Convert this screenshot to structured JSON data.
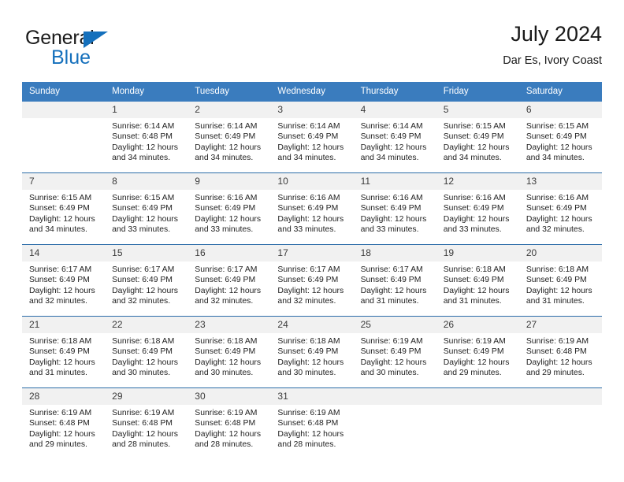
{
  "brand": {
    "name_top": "General",
    "name_bottom": "Blue",
    "accent_color": "#1570bc"
  },
  "header": {
    "title": "July 2024",
    "subtitle": "Dar Es, Ivory Coast",
    "header_bg_color": "#3a7cbe",
    "week_divider_color": "#2b6ca8",
    "daynum_bg_color": "#f1f1f1"
  },
  "weekday_headers": [
    "Sunday",
    "Monday",
    "Tuesday",
    "Wednesday",
    "Thursday",
    "Friday",
    "Saturday"
  ],
  "weeks": [
    [
      {
        "day": "",
        "sunrise": "",
        "sunset": "",
        "daylight": "",
        "daylight2": "",
        "empty": true
      },
      {
        "day": "1",
        "sunrise": "Sunrise: 6:14 AM",
        "sunset": "Sunset: 6:48 PM",
        "daylight": "Daylight: 12 hours",
        "daylight2": "and 34 minutes."
      },
      {
        "day": "2",
        "sunrise": "Sunrise: 6:14 AM",
        "sunset": "Sunset: 6:49 PM",
        "daylight": "Daylight: 12 hours",
        "daylight2": "and 34 minutes."
      },
      {
        "day": "3",
        "sunrise": "Sunrise: 6:14 AM",
        "sunset": "Sunset: 6:49 PM",
        "daylight": "Daylight: 12 hours",
        "daylight2": "and 34 minutes."
      },
      {
        "day": "4",
        "sunrise": "Sunrise: 6:14 AM",
        "sunset": "Sunset: 6:49 PM",
        "daylight": "Daylight: 12 hours",
        "daylight2": "and 34 minutes."
      },
      {
        "day": "5",
        "sunrise": "Sunrise: 6:15 AM",
        "sunset": "Sunset: 6:49 PM",
        "daylight": "Daylight: 12 hours",
        "daylight2": "and 34 minutes."
      },
      {
        "day": "6",
        "sunrise": "Sunrise: 6:15 AM",
        "sunset": "Sunset: 6:49 PM",
        "daylight": "Daylight: 12 hours",
        "daylight2": "and 34 minutes."
      }
    ],
    [
      {
        "day": "7",
        "sunrise": "Sunrise: 6:15 AM",
        "sunset": "Sunset: 6:49 PM",
        "daylight": "Daylight: 12 hours",
        "daylight2": "and 34 minutes."
      },
      {
        "day": "8",
        "sunrise": "Sunrise: 6:15 AM",
        "sunset": "Sunset: 6:49 PM",
        "daylight": "Daylight: 12 hours",
        "daylight2": "and 33 minutes."
      },
      {
        "day": "9",
        "sunrise": "Sunrise: 6:16 AM",
        "sunset": "Sunset: 6:49 PM",
        "daylight": "Daylight: 12 hours",
        "daylight2": "and 33 minutes."
      },
      {
        "day": "10",
        "sunrise": "Sunrise: 6:16 AM",
        "sunset": "Sunset: 6:49 PM",
        "daylight": "Daylight: 12 hours",
        "daylight2": "and 33 minutes."
      },
      {
        "day": "11",
        "sunrise": "Sunrise: 6:16 AM",
        "sunset": "Sunset: 6:49 PM",
        "daylight": "Daylight: 12 hours",
        "daylight2": "and 33 minutes."
      },
      {
        "day": "12",
        "sunrise": "Sunrise: 6:16 AM",
        "sunset": "Sunset: 6:49 PM",
        "daylight": "Daylight: 12 hours",
        "daylight2": "and 33 minutes."
      },
      {
        "day": "13",
        "sunrise": "Sunrise: 6:16 AM",
        "sunset": "Sunset: 6:49 PM",
        "daylight": "Daylight: 12 hours",
        "daylight2": "and 32 minutes."
      }
    ],
    [
      {
        "day": "14",
        "sunrise": "Sunrise: 6:17 AM",
        "sunset": "Sunset: 6:49 PM",
        "daylight": "Daylight: 12 hours",
        "daylight2": "and 32 minutes."
      },
      {
        "day": "15",
        "sunrise": "Sunrise: 6:17 AM",
        "sunset": "Sunset: 6:49 PM",
        "daylight": "Daylight: 12 hours",
        "daylight2": "and 32 minutes."
      },
      {
        "day": "16",
        "sunrise": "Sunrise: 6:17 AM",
        "sunset": "Sunset: 6:49 PM",
        "daylight": "Daylight: 12 hours",
        "daylight2": "and 32 minutes."
      },
      {
        "day": "17",
        "sunrise": "Sunrise: 6:17 AM",
        "sunset": "Sunset: 6:49 PM",
        "daylight": "Daylight: 12 hours",
        "daylight2": "and 32 minutes."
      },
      {
        "day": "18",
        "sunrise": "Sunrise: 6:17 AM",
        "sunset": "Sunset: 6:49 PM",
        "daylight": "Daylight: 12 hours",
        "daylight2": "and 31 minutes."
      },
      {
        "day": "19",
        "sunrise": "Sunrise: 6:18 AM",
        "sunset": "Sunset: 6:49 PM",
        "daylight": "Daylight: 12 hours",
        "daylight2": "and 31 minutes."
      },
      {
        "day": "20",
        "sunrise": "Sunrise: 6:18 AM",
        "sunset": "Sunset: 6:49 PM",
        "daylight": "Daylight: 12 hours",
        "daylight2": "and 31 minutes."
      }
    ],
    [
      {
        "day": "21",
        "sunrise": "Sunrise: 6:18 AM",
        "sunset": "Sunset: 6:49 PM",
        "daylight": "Daylight: 12 hours",
        "daylight2": "and 31 minutes."
      },
      {
        "day": "22",
        "sunrise": "Sunrise: 6:18 AM",
        "sunset": "Sunset: 6:49 PM",
        "daylight": "Daylight: 12 hours",
        "daylight2": "and 30 minutes."
      },
      {
        "day": "23",
        "sunrise": "Sunrise: 6:18 AM",
        "sunset": "Sunset: 6:49 PM",
        "daylight": "Daylight: 12 hours",
        "daylight2": "and 30 minutes."
      },
      {
        "day": "24",
        "sunrise": "Sunrise: 6:18 AM",
        "sunset": "Sunset: 6:49 PM",
        "daylight": "Daylight: 12 hours",
        "daylight2": "and 30 minutes."
      },
      {
        "day": "25",
        "sunrise": "Sunrise: 6:19 AM",
        "sunset": "Sunset: 6:49 PM",
        "daylight": "Daylight: 12 hours",
        "daylight2": "and 30 minutes."
      },
      {
        "day": "26",
        "sunrise": "Sunrise: 6:19 AM",
        "sunset": "Sunset: 6:49 PM",
        "daylight": "Daylight: 12 hours",
        "daylight2": "and 29 minutes."
      },
      {
        "day": "27",
        "sunrise": "Sunrise: 6:19 AM",
        "sunset": "Sunset: 6:48 PM",
        "daylight": "Daylight: 12 hours",
        "daylight2": "and 29 minutes."
      }
    ],
    [
      {
        "day": "28",
        "sunrise": "Sunrise: 6:19 AM",
        "sunset": "Sunset: 6:48 PM",
        "daylight": "Daylight: 12 hours",
        "daylight2": "and 29 minutes."
      },
      {
        "day": "29",
        "sunrise": "Sunrise: 6:19 AM",
        "sunset": "Sunset: 6:48 PM",
        "daylight": "Daylight: 12 hours",
        "daylight2": "and 28 minutes."
      },
      {
        "day": "30",
        "sunrise": "Sunrise: 6:19 AM",
        "sunset": "Sunset: 6:48 PM",
        "daylight": "Daylight: 12 hours",
        "daylight2": "and 28 minutes."
      },
      {
        "day": "31",
        "sunrise": "Sunrise: 6:19 AM",
        "sunset": "Sunset: 6:48 PM",
        "daylight": "Daylight: 12 hours",
        "daylight2": "and 28 minutes."
      },
      {
        "day": "",
        "sunrise": "",
        "sunset": "",
        "daylight": "",
        "daylight2": "",
        "empty": true
      },
      {
        "day": "",
        "sunrise": "",
        "sunset": "",
        "daylight": "",
        "daylight2": "",
        "empty": true
      },
      {
        "day": "",
        "sunrise": "",
        "sunset": "",
        "daylight": "",
        "daylight2": "",
        "empty": true
      }
    ]
  ]
}
